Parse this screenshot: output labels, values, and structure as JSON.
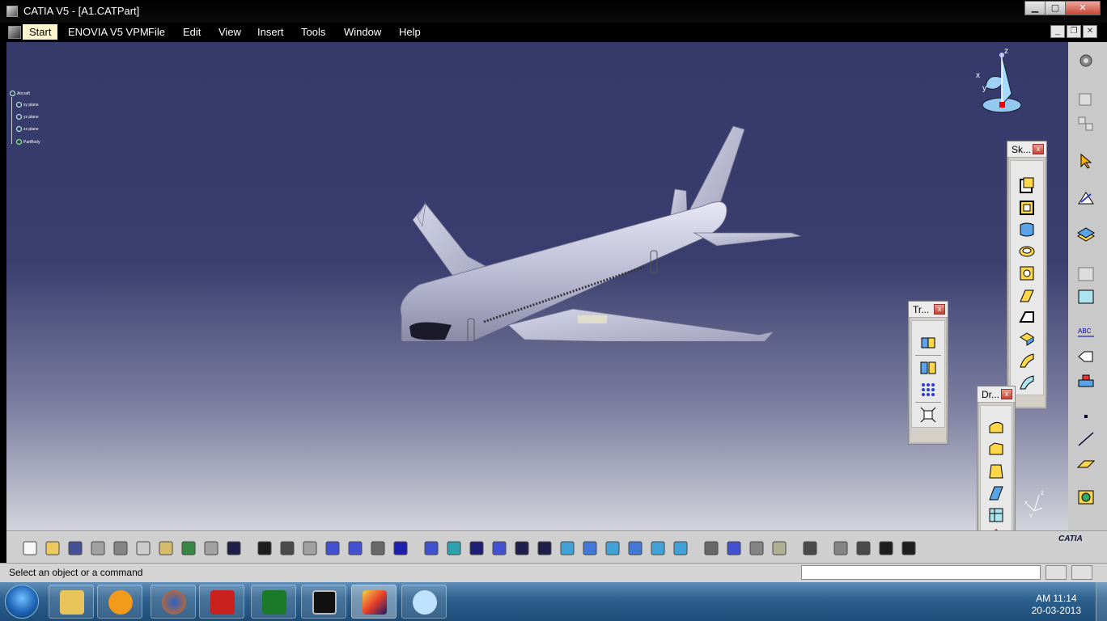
{
  "window": {
    "title": "CATIA V5 - [A1.CATPart]",
    "min": "▁",
    "max": "▢",
    "close": "✕"
  },
  "menu": {
    "start": "Start",
    "items": [
      "ENOVIA V5 VPM",
      "File",
      "Edit",
      "View",
      "Insert",
      "Tools",
      "Window",
      "Help"
    ]
  },
  "tree": {
    "root": "Aircraft",
    "children": [
      "xy plane",
      "yz plane",
      "zx plane",
      "PartBody"
    ]
  },
  "compass": {
    "x": "x",
    "y": "y",
    "z": "z"
  },
  "mini_axis": {
    "x": "x",
    "y": "y",
    "z": "z"
  },
  "toolbars": {
    "sketch": "Sk...",
    "transform": "Tr...",
    "dressup": "Dr...",
    "close": "x"
  },
  "brand": "CATIA",
  "status": {
    "message": "Select an object or a command"
  },
  "taskbar": {
    "time": "AM 11:14",
    "date": "20-03-2013"
  },
  "icons": {
    "bottom": [
      "new-icon",
      "open-icon",
      "save-icon",
      "print-icon",
      "cut-icon",
      "copy-icon",
      "paste-icon",
      "undo-icon",
      "redo-icon",
      "whats-this-icon",
      "formula-icon",
      "comment-icon",
      "link-icon",
      "table-icon",
      "tree-icon",
      "lock-icon",
      "knowledge-icon",
      "fly-icon",
      "fit-all-icon",
      "pan-icon",
      "rotate-icon",
      "zoom-in-icon",
      "zoom-out-icon",
      "normal-view-icon",
      "multi-view-icon",
      "iso-view-icon",
      "shading-icon",
      "hide-show-icon",
      "swap-visible-icon",
      "capture-icon",
      "measure-icon",
      "apply-material-icon",
      "mass-icon",
      "camera-icon",
      "update-icon",
      "hand-icon",
      "axis-icon",
      "scale-icon"
    ],
    "right": [
      "settings-icon",
      "part-icon",
      "product-icon",
      "select-icon",
      "sketcher-icon",
      "layer-icon",
      "spec-icon",
      "insert-icon",
      "text-icon",
      "annotation-icon",
      "constraint-icon",
      "point-icon",
      "line-icon",
      "plane-icon",
      "analysis-icon"
    ]
  }
}
